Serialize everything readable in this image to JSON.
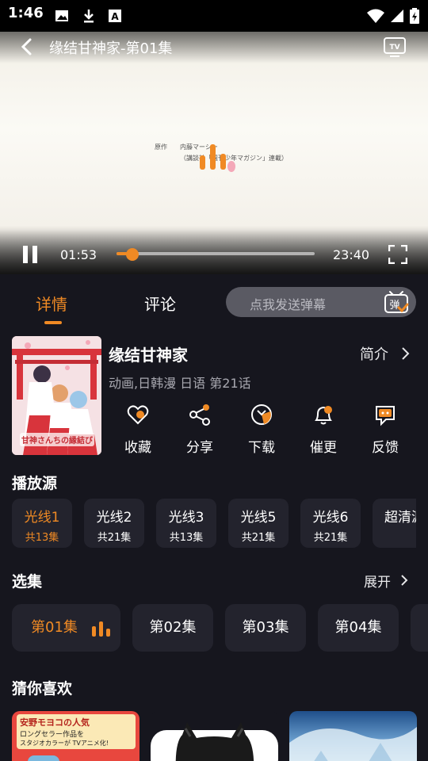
{
  "status_bar": {
    "time": "1:46"
  },
  "player": {
    "title": "缘结甘神家-第01集",
    "current_time": "01:53",
    "total_time": "23:40",
    "progress": 0.08,
    "credit_line1": "原作　　内藤マーシー",
    "credit_line2": "（講談社「週刊少年マガジン」連載）"
  },
  "tabs": [
    {
      "label": "详情"
    },
    {
      "label": "评论"
    }
  ],
  "danmu": {
    "placeholder": "点我发送弹幕",
    "badge": "弹"
  },
  "anime": {
    "title": "缘结甘神家",
    "meta": "动画,日韩漫 日语 第21话",
    "intro_label": "简介",
    "poster_text": "甘神さんちの縁結び"
  },
  "actions": [
    {
      "label": "收藏",
      "icon": "heart-icon"
    },
    {
      "label": "分享",
      "icon": "share-icon"
    },
    {
      "label": "下载",
      "icon": "download-icon"
    },
    {
      "label": "催更",
      "icon": "bell-icon"
    },
    {
      "label": "反馈",
      "icon": "feedback-icon"
    }
  ],
  "sources_section": {
    "title": "播放源"
  },
  "sources": [
    {
      "name": "光线1",
      "count": "共13集"
    },
    {
      "name": "光线2",
      "count": "共21集"
    },
    {
      "name": "光线3",
      "count": "共13集"
    },
    {
      "name": "光线5",
      "count": "共21集"
    },
    {
      "name": "光线6",
      "count": "共21集"
    },
    {
      "name": "超清源",
      "count": ""
    }
  ],
  "episodes_section": {
    "title": "选集",
    "expand_label": "展开"
  },
  "episodes": [
    {
      "label": "第01集"
    },
    {
      "label": "第02集"
    },
    {
      "label": "第03集"
    },
    {
      "label": "第04集"
    }
  ],
  "recommend_section": {
    "title": "猜你喜欢"
  },
  "recommend_cards": [
    {
      "line1": "安野モヨコの人気",
      "line2": "ロングセラー作品を",
      "line3": "スタジオカラーが TVアニメ化!"
    }
  ],
  "colors": {
    "accent": "#f08a24",
    "background": "#16161e",
    "card": "#23232d"
  }
}
